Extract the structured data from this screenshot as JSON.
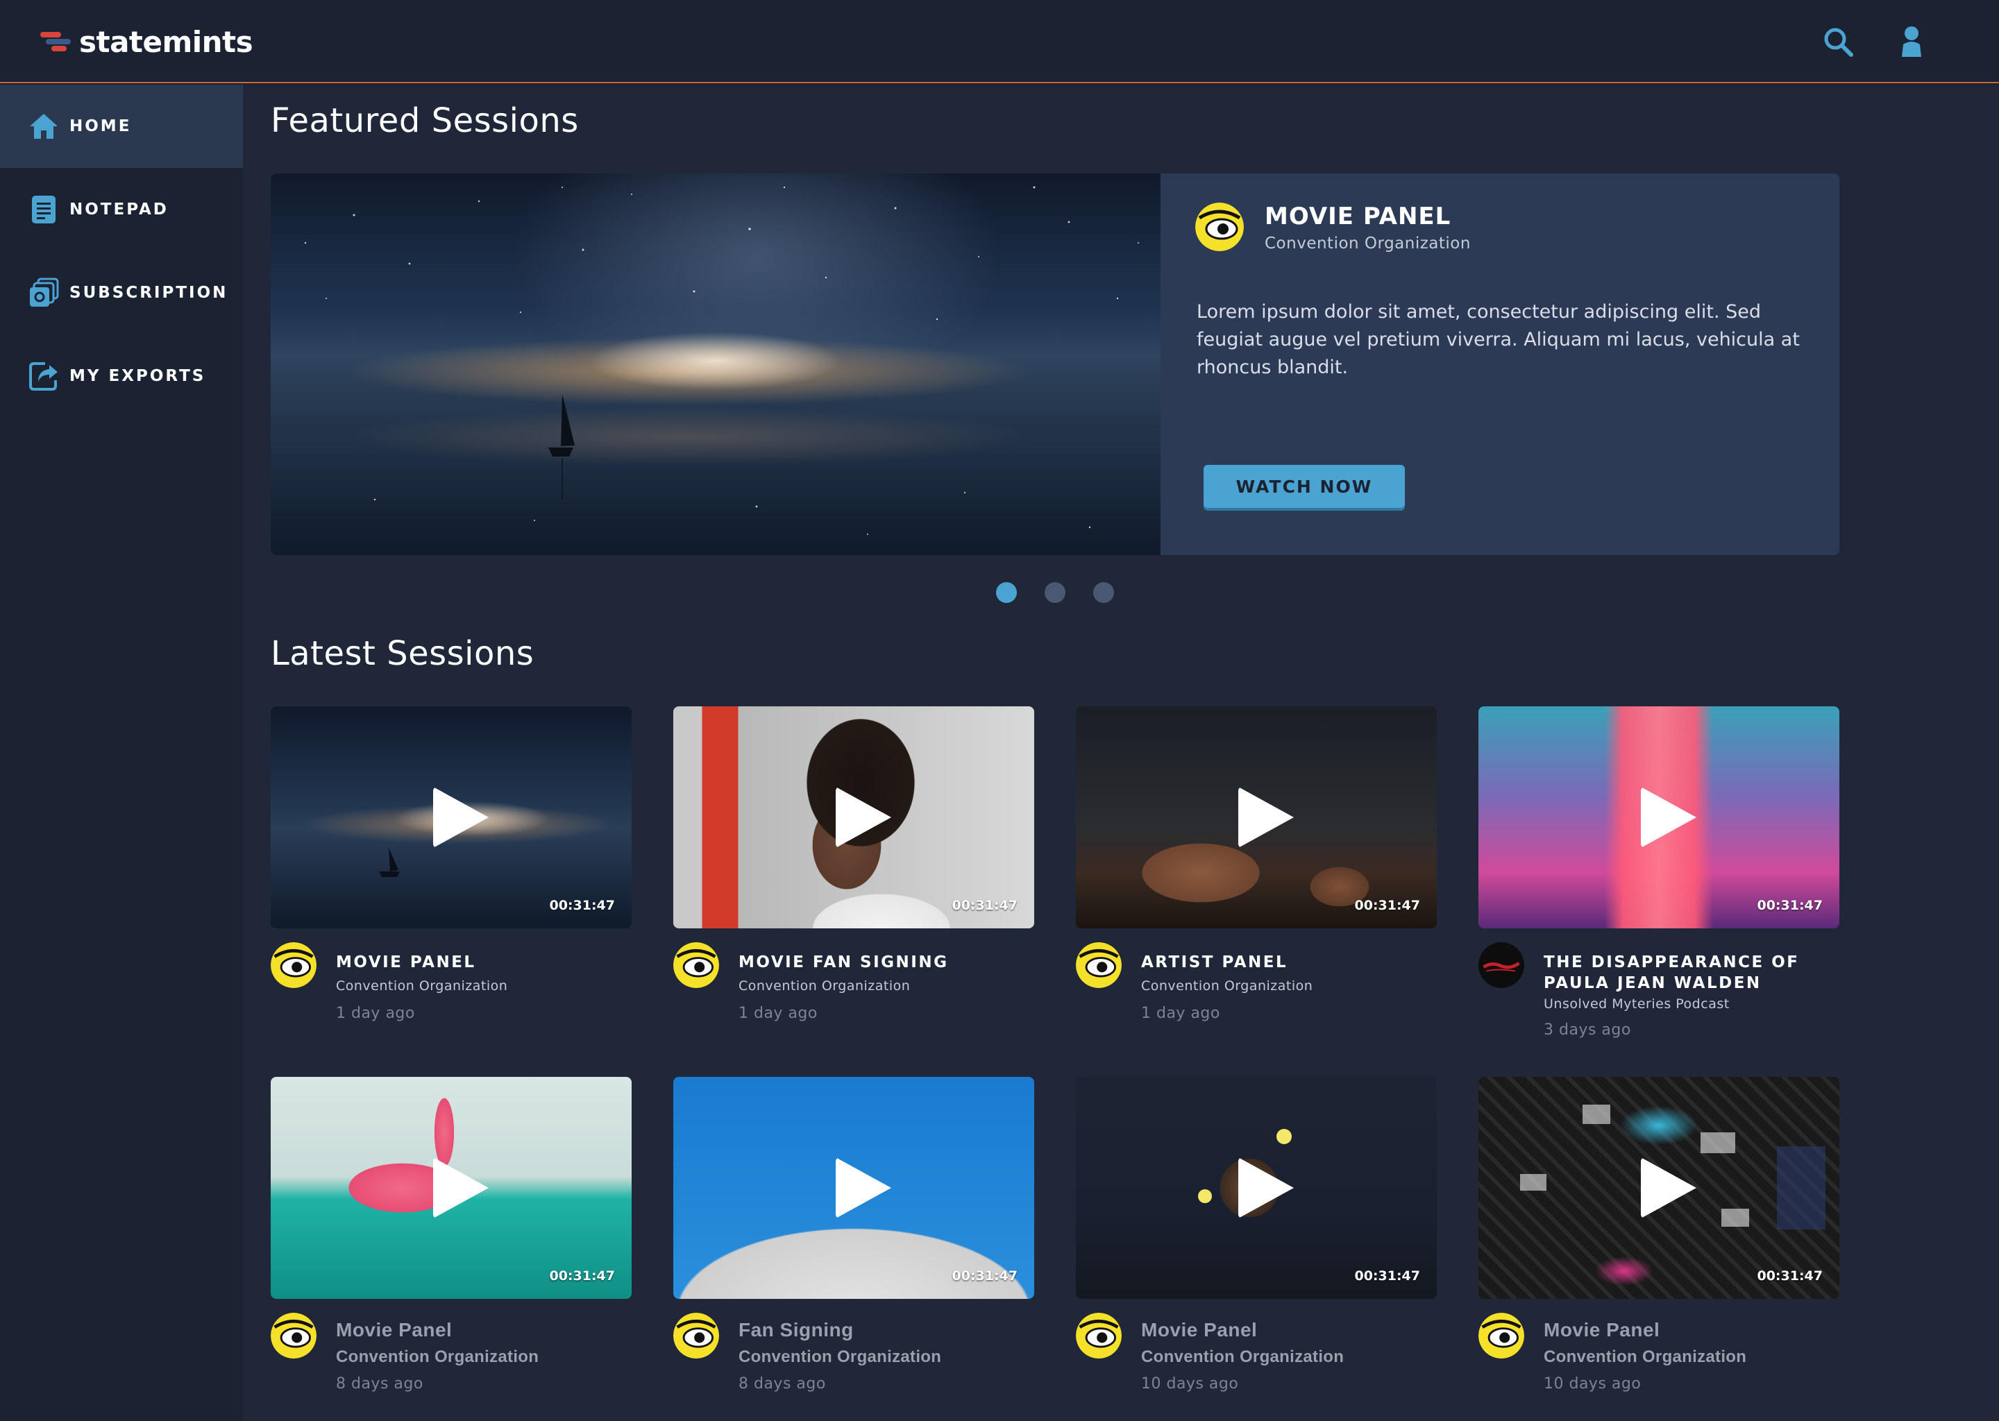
{
  "brand": {
    "name": "statemints"
  },
  "header": {
    "search_icon": "search-icon",
    "user_icon": "user-icon"
  },
  "sidebar": {
    "items": [
      {
        "label": "HOME",
        "icon": "home-icon",
        "active": true
      },
      {
        "label": "NOTEPAD",
        "icon": "notepad-icon",
        "active": false
      },
      {
        "label": "SUBSCRIPTION",
        "icon": "subscription-icon",
        "active": false
      },
      {
        "label": "MY EXPORTS",
        "icon": "export-icon",
        "active": false
      }
    ]
  },
  "featured": {
    "heading": "Featured Sessions",
    "title": "MOVIE PANEL",
    "org": "Convention Organization",
    "description": "Lorem ipsum dolor sit amet, consectetur adipiscing elit. Sed feugiat augue vel pretium viverra. Aliquam mi lacus, vehicula at rhoncus blandit.",
    "button": "WATCH NOW",
    "slides": 3,
    "active_slide": 1
  },
  "latest": {
    "heading": "Latest Sessions",
    "cards": [
      {
        "title": "MOVIE PANEL",
        "org": "Convention Organization",
        "age": "1 day ago",
        "duration": "00:31:47"
      },
      {
        "title": "MOVIE FAN SIGNING",
        "org": "Convention Organization",
        "age": "1 day ago",
        "duration": "00:31:47"
      },
      {
        "title": "ARTIST PANEL",
        "org": "Convention Organization",
        "age": "1 day ago",
        "duration": "00:31:47"
      },
      {
        "title": "THE DISAPPEARANCE OF PAULA JEAN WALDEN",
        "org": "Unsolved Myteries Podcast",
        "age": "3 days ago",
        "duration": "00:31:47"
      },
      {
        "title": "Movie Panel",
        "org": "Convention Organization",
        "age": "8 days ago",
        "duration": "00:31:47"
      },
      {
        "title": "Fan Signing",
        "org": "Convention Organization",
        "age": "8 days ago",
        "duration": "00:31:47"
      },
      {
        "title": "Movie Panel",
        "org": "Convention Organization",
        "age": "10 days ago",
        "duration": "00:31:47"
      },
      {
        "title": "Movie Panel",
        "org": "Convention Organization",
        "age": "10 days ago",
        "duration": "00:31:47"
      }
    ]
  },
  "colors": {
    "accent": "#4aa3d1",
    "divider": "#c86b3c",
    "background": "#1f2738",
    "panel": "#2c3a55"
  }
}
